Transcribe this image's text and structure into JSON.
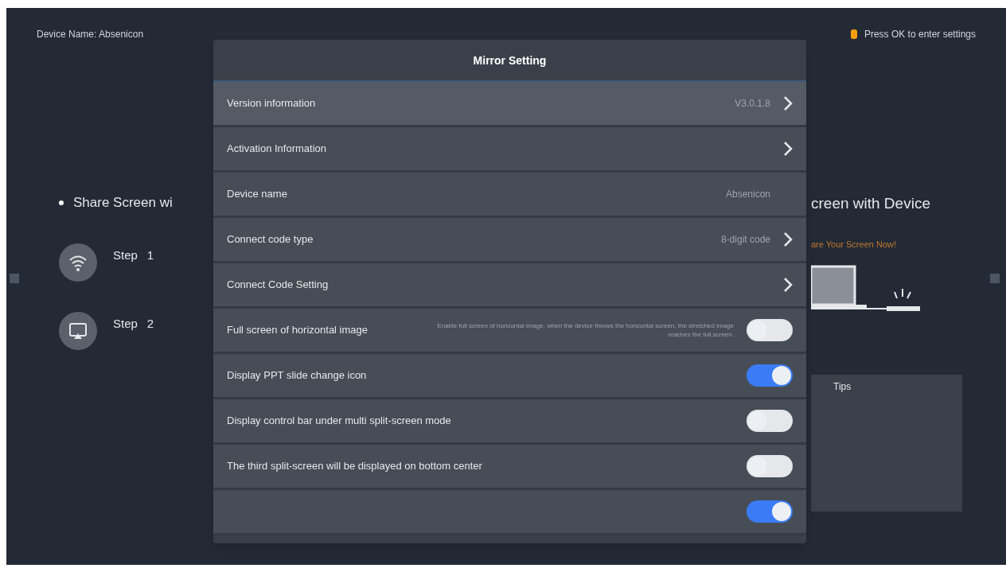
{
  "header": {
    "device_name": "Device Name: Absenicon",
    "hint": "Press OK to enter settings"
  },
  "background": {
    "left_heading": "Share Screen wi",
    "steps": [
      {
        "label": "Step",
        "number": "1",
        "kind": "wifi"
      },
      {
        "label": "Step",
        "number": "2",
        "kind": "cast"
      }
    ],
    "right_heading": "creen with Device",
    "right_link": "are Your Screen Now!",
    "tips_title": "Tips"
  },
  "dialog": {
    "title": "Mirror Setting",
    "rows": [
      {
        "kind": "link",
        "label": "Version information",
        "value": "V3.0.1.8",
        "selected": true
      },
      {
        "kind": "link",
        "label": "Activation Information",
        "selected": false
      },
      {
        "kind": "text",
        "label": "Device name",
        "value": "Absenicon",
        "selected": false
      },
      {
        "kind": "link",
        "label": "Connect code type",
        "value": "8-digit code",
        "selected": false
      },
      {
        "kind": "link",
        "label": "Connect Code Setting",
        "selected": false
      },
      {
        "kind": "toggle",
        "label": "Full screen of horizontal image",
        "description": "Enable full screen of horizontal image, when the device throws the horizontal screen, the stretched image reaches the full screen.",
        "on": false,
        "selected": false
      },
      {
        "kind": "toggle",
        "label": "Display PPT slide change icon",
        "on": true,
        "selected": false
      },
      {
        "kind": "toggle",
        "label": "Display control bar under multi split-screen mode",
        "on": false,
        "selected": false
      },
      {
        "kind": "toggle",
        "label": "The third split-screen will be displayed on bottom center",
        "on": false,
        "selected": false
      },
      {
        "kind": "toggle",
        "on": true,
        "selected": false
      }
    ]
  }
}
